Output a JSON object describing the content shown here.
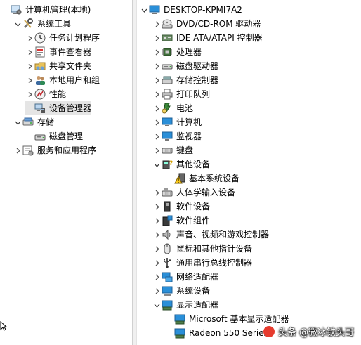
{
  "left_tree": [
    {
      "name": "computer-management-root",
      "label": "计算机管理(本地)",
      "icon": "computer-management-icon",
      "arrow": "",
      "level": 0,
      "selected": false
    },
    {
      "name": "system-tools",
      "label": "系统工具",
      "icon": "system-tools-icon",
      "arrow": "expanded",
      "level": 1,
      "selected": false
    },
    {
      "name": "task-scheduler",
      "label": "任务计划程序",
      "icon": "clock-icon",
      "arrow": "collapsed",
      "level": 2,
      "selected": false
    },
    {
      "name": "event-viewer",
      "label": "事件查看器",
      "icon": "event-viewer-icon",
      "arrow": "collapsed",
      "level": 2,
      "selected": false
    },
    {
      "name": "shared-folders",
      "label": "共享文件夹",
      "icon": "shared-folder-icon",
      "arrow": "collapsed",
      "level": 2,
      "selected": false
    },
    {
      "name": "local-users-groups",
      "label": "本地用户和组",
      "icon": "users-icon",
      "arrow": "collapsed",
      "level": 2,
      "selected": false
    },
    {
      "name": "performance",
      "label": "性能",
      "icon": "performance-icon",
      "arrow": "collapsed",
      "level": 2,
      "selected": false
    },
    {
      "name": "device-manager",
      "label": "设备管理器",
      "icon": "device-manager-icon",
      "arrow": "",
      "level": 2,
      "selected": true
    },
    {
      "name": "storage",
      "label": "存储",
      "icon": "storage-icon",
      "arrow": "expanded",
      "level": 1,
      "selected": false
    },
    {
      "name": "disk-management",
      "label": "磁盘管理",
      "icon": "disk-management-icon",
      "arrow": "",
      "level": 2,
      "selected": false
    },
    {
      "name": "services-applications",
      "label": "服务和应用程序",
      "icon": "services-icon",
      "arrow": "collapsed",
      "level": 1,
      "selected": false
    }
  ],
  "device_tree": [
    {
      "name": "computer-root",
      "label": "DESKTOP-KPMI7A2",
      "icon": "computer-root-icon",
      "arrow": "expanded",
      "level": 0
    },
    {
      "name": "dvd-drives",
      "label": "DVD/CD-ROM 驱动器",
      "icon": "dvd-icon",
      "arrow": "collapsed",
      "level": 1
    },
    {
      "name": "ide-controllers",
      "label": "IDE ATA/ATAPI 控制器",
      "icon": "ide-controller-icon",
      "arrow": "collapsed",
      "level": 1
    },
    {
      "name": "processors",
      "label": "处理器",
      "icon": "processor-icon",
      "arrow": "collapsed",
      "level": 1
    },
    {
      "name": "disk-drives",
      "label": "磁盘驱动器",
      "icon": "disk-drive-icon",
      "arrow": "collapsed",
      "level": 1
    },
    {
      "name": "storage-controllers",
      "label": "存储控制器",
      "icon": "storage-controller-icon",
      "arrow": "collapsed",
      "level": 1
    },
    {
      "name": "print-queues",
      "label": "打印队列",
      "icon": "printer-icon",
      "arrow": "collapsed",
      "level": 1
    },
    {
      "name": "batteries",
      "label": "电池",
      "icon": "battery-icon",
      "arrow": "collapsed",
      "level": 1
    },
    {
      "name": "computer",
      "label": "计算机",
      "icon": "monitor-icon",
      "arrow": "collapsed",
      "level": 1
    },
    {
      "name": "monitors",
      "label": "监视器",
      "icon": "monitor-icon",
      "arrow": "collapsed",
      "level": 1
    },
    {
      "name": "keyboards",
      "label": "键盘",
      "icon": "keyboard-icon",
      "arrow": "collapsed",
      "level": 1
    },
    {
      "name": "other-devices",
      "label": "其他设备",
      "icon": "unknown-device-icon",
      "arrow": "expanded",
      "level": 1
    },
    {
      "name": "base-system-device",
      "label": "基本系统设备",
      "icon": "warning-device-icon",
      "arrow": "",
      "level": 2
    },
    {
      "name": "hid",
      "label": "人体学输入设备",
      "icon": "hid-icon",
      "arrow": "collapsed",
      "level": 1
    },
    {
      "name": "software-devices",
      "label": "软件设备",
      "icon": "software-device-icon",
      "arrow": "collapsed",
      "level": 1
    },
    {
      "name": "software-components",
      "label": "软件组件",
      "icon": "software-component-icon",
      "arrow": "collapsed",
      "level": 1
    },
    {
      "name": "sound-controllers",
      "label": "声音、视频和游戏控制器",
      "icon": "speaker-icon",
      "arrow": "collapsed",
      "level": 1
    },
    {
      "name": "mice",
      "label": "鼠标和其他指针设备",
      "icon": "mouse-icon",
      "arrow": "collapsed",
      "level": 1
    },
    {
      "name": "usb-controllers",
      "label": "通用串行总线控制器",
      "icon": "usb-icon",
      "arrow": "collapsed",
      "level": 1
    },
    {
      "name": "network-adapters",
      "label": "网络适配器",
      "icon": "network-icon",
      "arrow": "collapsed",
      "level": 1
    },
    {
      "name": "system-devices",
      "label": "系统设备",
      "icon": "system-device-icon",
      "arrow": "collapsed",
      "level": 1
    },
    {
      "name": "display-adapters",
      "label": "显示适配器",
      "icon": "display-adapter-icon",
      "arrow": "expanded",
      "level": 1
    },
    {
      "name": "ms-basic-display",
      "label": "Microsoft 基本显示适配器",
      "icon": "display-adapter-icon",
      "arrow": "",
      "level": 2
    },
    {
      "name": "radeon-550",
      "label": "Radeon 550 Series",
      "icon": "display-adapter-icon",
      "arrow": "",
      "level": 2
    }
  ],
  "watermark": {
    "text": "头条 @微冰铁头哥"
  },
  "colors": {
    "selection": "#e5e5e5",
    "monitor_blue": "#2a8fd8",
    "warning_yellow": "#f5c518"
  }
}
